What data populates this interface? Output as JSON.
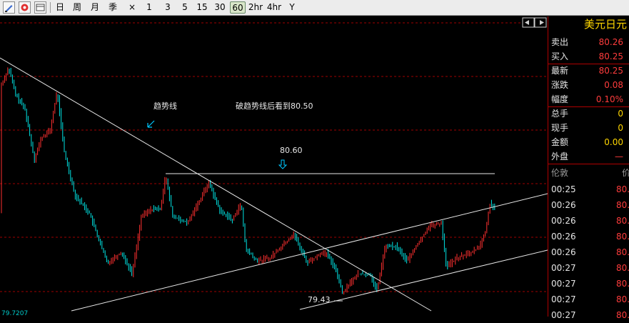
{
  "toolbar": {
    "periods": [
      "日",
      "周",
      "月",
      "季",
      "×",
      "1",
      "3",
      "5",
      "15",
      "30",
      "60",
      "2hr",
      "4hr",
      "Y"
    ],
    "active_period": "60"
  },
  "chart": {
    "annotations": {
      "trendline": "趋势线",
      "breakout": "破趋势线后看到80.50",
      "level_high": "80.60",
      "level_low": "79.43",
      "bottom_left": "79.7207"
    },
    "colors": {
      "up": "#ff3030",
      "down": "#00e5e5",
      "grid": "#a00000",
      "line": "#e8e8e8"
    }
  },
  "panel": {
    "title": "美元日元",
    "quotes": [
      {
        "label": "卖出",
        "value": "80.26",
        "color": "#ff3c3c"
      },
      {
        "label": "买入",
        "value": "80.25",
        "color": "#ff3c3c"
      },
      {
        "label": "最新",
        "value": "80.25",
        "color": "#ff3c3c"
      },
      {
        "label": "涨跌",
        "value": "0.08",
        "color": "#ff3c3c"
      },
      {
        "label": "幅度",
        "value": "0.10%",
        "color": "#ff3c3c"
      },
      {
        "label": "总手",
        "value": "0",
        "color": "#ffd700"
      },
      {
        "label": "现手",
        "value": "0",
        "color": "#ffd700"
      },
      {
        "label": "金额",
        "value": "0.00",
        "color": "#ffd700"
      },
      {
        "label": "外盘",
        "value": "—",
        "color": "#ff3c3c"
      }
    ],
    "ticks_header": {
      "time": "伦敦",
      "price": "价"
    },
    "ticks": [
      {
        "time": "00:25",
        "price": "80."
      },
      {
        "time": "00:26",
        "price": "80."
      },
      {
        "time": "00:26",
        "price": "80."
      },
      {
        "time": "00:26",
        "price": "80."
      },
      {
        "time": "00:26",
        "price": "80."
      },
      {
        "time": "00:27",
        "price": "80."
      },
      {
        "time": "00:27",
        "price": "80."
      },
      {
        "time": "00:27",
        "price": "80."
      },
      {
        "time": "00:27",
        "price": "80."
      }
    ]
  }
}
